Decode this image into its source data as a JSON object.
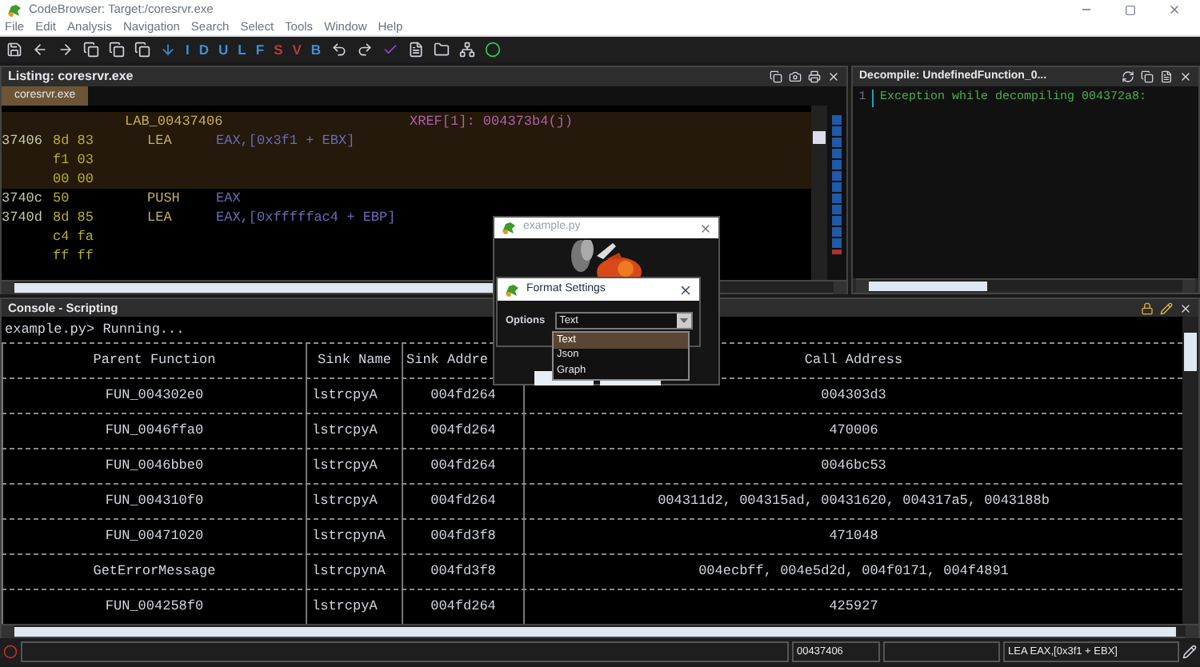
{
  "window": {
    "title": "CodeBrowser: Target:/coresrvr.exe"
  },
  "menu": [
    "File",
    "Edit",
    "Analysis",
    "Navigation",
    "Search",
    "Select",
    "Tools",
    "Window",
    "Help"
  ],
  "toolbar": {
    "letters": [
      {
        "label": "I",
        "color": "#3d8fd6"
      },
      {
        "label": "D",
        "color": "#3d8fd6"
      },
      {
        "label": "U",
        "color": "#3d8fd6"
      },
      {
        "label": "L",
        "color": "#3d8fd6"
      },
      {
        "label": "F",
        "color": "#3d8fd6"
      },
      {
        "label": "S",
        "color": "#b8383b"
      },
      {
        "label": "V",
        "color": "#b8383b"
      },
      {
        "label": "B",
        "color": "#3d8fd6"
      }
    ]
  },
  "listing": {
    "title": "Listing: coresrvr.exe",
    "tabs": [
      {
        "label": "coresrvr.exe",
        "selected": true
      }
    ],
    "lines": [
      {
        "label": "LAB_00437406",
        "xref": "XREF[1]:  004373b4(j)",
        "highlighted": true
      },
      {
        "address": "37406",
        "bytes": "8d 83",
        "mnemonic": "LEA",
        "operand": "EAX,[0x3f1 + EBX]",
        "highlighted": true
      },
      {
        "bytes": "f1 03",
        "highlighted": true
      },
      {
        "bytes": "00 00",
        "highlighted": true
      },
      {
        "address": "3740c",
        "bytes": "50",
        "mnemonic": "PUSH",
        "operand": "EAX",
        "highlighted": false
      },
      {
        "address": "3740d",
        "bytes": "8d 85",
        "mnemonic": "LEA",
        "operand": "EAX,[0xfffffac4 + EBP]",
        "highlighted": false
      },
      {
        "bytes": "c4 fa",
        "highlighted": false
      },
      {
        "bytes": "ff ff",
        "highlighted": false
      }
    ]
  },
  "decompile": {
    "title": "Decompile: UndefinedFunction_0...",
    "lines": [
      {
        "number": "1",
        "text": "Exception while decompiling 004372a8:"
      }
    ]
  },
  "console": {
    "title": "Console - Scripting",
    "output": "example.py> Running...",
    "columns": [
      "Parent Function",
      "Sink Name",
      "Sink Addre",
      "Call Address"
    ],
    "rows": [
      {
        "parent": "FUN_004302e0",
        "sink_name": "lstrcpyA",
        "sink_address": "004fd264",
        "call_address": "004303d3"
      },
      {
        "parent": "FUN_0046ffa0",
        "sink_name": "lstrcpyA",
        "sink_address": "004fd264",
        "call_address": "470006"
      },
      {
        "parent": "FUN_0046bbe0",
        "sink_name": "lstrcpyA",
        "sink_address": "004fd264",
        "call_address": "0046bc53"
      },
      {
        "parent": "FUN_004310f0",
        "sink_name": "lstrcpyA",
        "sink_address": "004fd264",
        "call_address": "004311d2, 004315ad, 00431620, 004317a5, 0043188b"
      },
      {
        "parent": "FUN_00471020",
        "sink_name": "lstrcpynA",
        "sink_address": "004fd3f8",
        "call_address": "471048"
      },
      {
        "parent": "GetErrorMessage",
        "sink_name": "lstrcpynA",
        "sink_address": "004fd3f8",
        "call_address": "004ecbff, 004e5d2d, 004f0171, 004f4891"
      },
      {
        "parent": "FUN_004258f0",
        "sink_name": "lstrcpyA",
        "sink_address": "004fd264",
        "call_address": "425927"
      }
    ]
  },
  "dialogs": {
    "script_window": {
      "title": "example.py"
    },
    "format_settings": {
      "title": "Format Settings",
      "label": "Options",
      "value": "Text",
      "options": [
        {
          "label": "Text",
          "selected": true
        },
        {
          "label": "Json",
          "selected": false
        },
        {
          "label": "Graph",
          "selected": false
        }
      ]
    }
  },
  "status_bar": {
    "address": "00437406",
    "instruction": "LEA EAX,[0x3f1 + EBX]"
  }
}
